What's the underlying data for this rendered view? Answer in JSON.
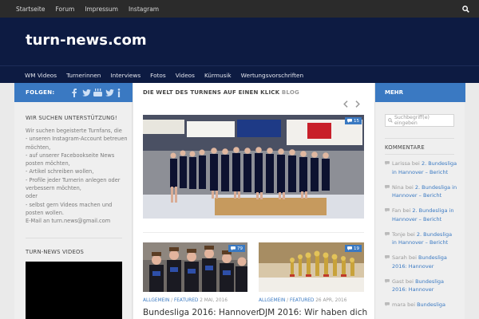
{
  "topnav": [
    "Startseite",
    "Forum",
    "Impressum",
    "Instagram"
  ],
  "site_title": "turn-news.com",
  "mainnav": [
    "WM Videos",
    "Turnerinnen",
    "Interviews",
    "Fotos",
    "Videos",
    "Kürmusik",
    "Wertungsvorschriften"
  ],
  "left": {
    "follow_label": "FOLGEN:",
    "social_icons": [
      "facebook-icon",
      "twitter-icon",
      "youtube-icon",
      "twitter-icon",
      "info-icon"
    ],
    "support_title": "WIR SUCHEN UNTERSTÜTZUNG!",
    "support_text": "Wir suchen begeisterte Turnfans, die\n- unseren Instagram-Account betreuen möchten,\n- auf unserer Facebookseite News posten möchten,\n- Artikel schreiben wollen,\n- Profile jeder Turnerin anlegen oder verbessern möchten,\noder\n- selbst gern Videos machen und posten wollen.\nE-Mail an turn.news@gmail.com",
    "videos_title": "TURN-NEWS VIDEOS"
  },
  "content": {
    "heading": "DIE WELT DES TURNENS AUF EINEN KLICK",
    "heading_suffix": "BLOG",
    "featured_comments": "15",
    "posts": [
      {
        "comments": "79",
        "cat1": "ALLGEMEIN",
        "cat2": "FEATURED",
        "date": "2 MAI, 2016",
        "title": "Bundesliga 2016: Hannover"
      },
      {
        "comments": "19",
        "cat1": "ALLGEMEIN",
        "cat2": "FEATURED",
        "date": "26 APR, 2016",
        "title": "DJM 2016: Wir haben dich"
      }
    ]
  },
  "right": {
    "mehr_label": "MEHR",
    "search_placeholder": "Suchbegriff(e) eingeben",
    "comments_title": "KOMMENTARE",
    "comments": [
      {
        "author": "Larissa",
        "on": "bei",
        "post": "2. Bundesliga in Hannover – Bericht"
      },
      {
        "author": "Nina",
        "on": "bei",
        "post": "2. Bundesliga in Hannover – Bericht"
      },
      {
        "author": "Fan",
        "on": "bei",
        "post": "2. Bundesliga in Hannover – Bericht"
      },
      {
        "author": "Tonje",
        "on": "bei",
        "post": "2. Bundesliga in Hannover – Bericht"
      },
      {
        "author": "Sarah",
        "on": "bei",
        "post": "Bundesliga 2016: Hannover"
      },
      {
        "author": "Gast",
        "on": "bei",
        "post": "Bundesliga 2016: Hannover"
      },
      {
        "author": "mara",
        "on": "bei",
        "post": "Bundesliga"
      }
    ]
  },
  "colors": {
    "accent": "#3a79c2",
    "header_bg": "#0d1b42",
    "topbar_bg": "#2b2b2b"
  }
}
